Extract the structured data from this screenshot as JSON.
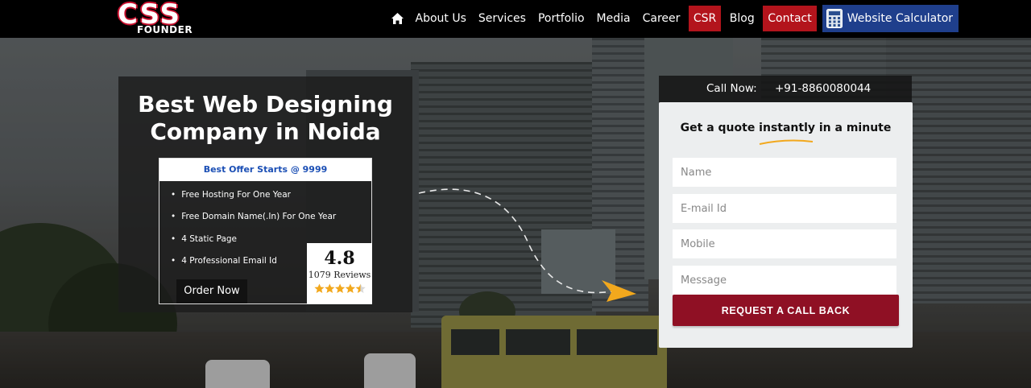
{
  "header": {
    "logo": {
      "main": "CSS",
      "sub": "FOUNDER",
      "color": "#c8102e"
    },
    "home_icon": "home-icon",
    "nav": [
      {
        "label": "About Us"
      },
      {
        "label": "Services"
      },
      {
        "label": "Portfolio"
      },
      {
        "label": "Media"
      },
      {
        "label": "Career"
      },
      {
        "label": "CSR",
        "highlight": "#b3141c"
      },
      {
        "label": "Blog"
      },
      {
        "label": "Contact",
        "highlight": "#b3141c"
      }
    ],
    "calculator": {
      "label": "Website Calculator",
      "icon": "calculator-icon",
      "color": "#1f3f8c"
    }
  },
  "hero": {
    "headline_line1": "Best Web Designing",
    "headline_line2": "Company in Noida",
    "offer": {
      "title": "Best Offer Starts @ 9999",
      "items": [
        "Free Hosting For One Year",
        "Free Domain Name(.In) For One Year",
        "4 Static Page",
        "4 Professional Email Id"
      ],
      "order_label": "Order Now"
    },
    "rating": {
      "score": "4.8",
      "reviews": "1079 Reviews",
      "stars": 4.5,
      "star_color": "#f2a81d"
    }
  },
  "contact": {
    "call_label": "Call Now:",
    "call_number": "+91-8860080044",
    "form_title": "Get a quote instantly in a minute",
    "accent": "#f2a81d",
    "fields": {
      "name_placeholder": "Name",
      "email_placeholder": "E-mail Id",
      "mobile_placeholder": "Mobile",
      "message_placeholder": "Message"
    },
    "submit_label": "REQUEST A CALL BACK",
    "submit_color": "#8f1024"
  }
}
